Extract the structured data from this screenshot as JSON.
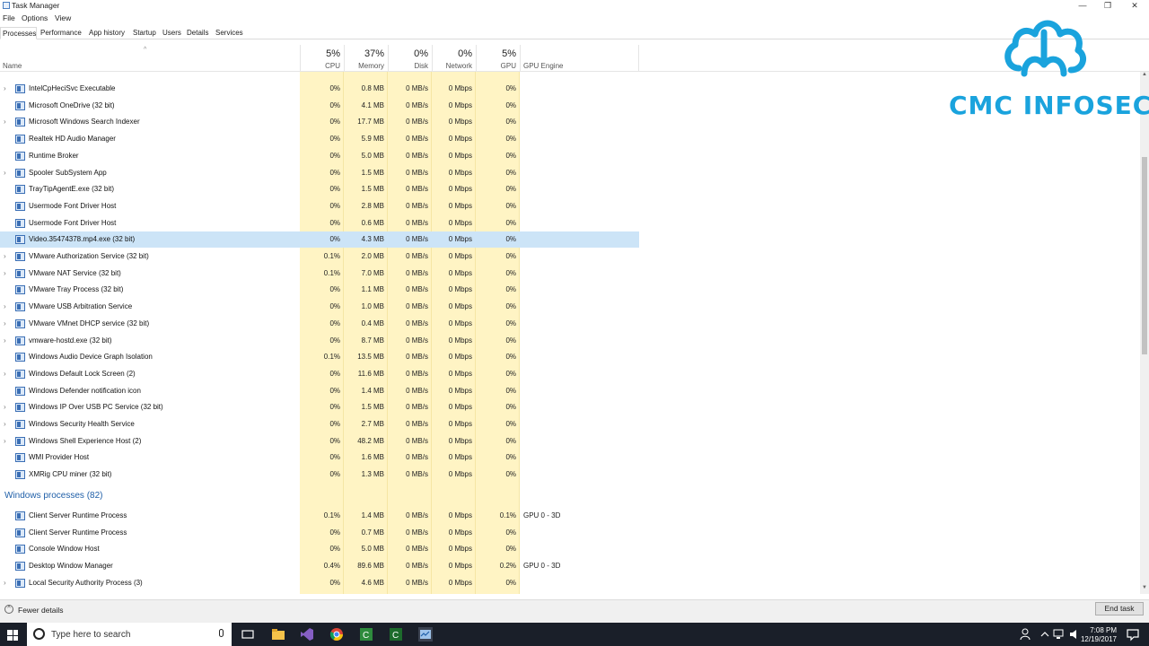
{
  "window": {
    "title": "Task Manager",
    "minimize": "—",
    "maximize": "❐",
    "close": "✕"
  },
  "menu": [
    "File",
    "Options",
    "View"
  ],
  "tabs": [
    {
      "label": "Processes",
      "active": true
    },
    {
      "label": "Performance"
    },
    {
      "label": "App history"
    },
    {
      "label": "Startup"
    },
    {
      "label": "Users"
    },
    {
      "label": "Details"
    },
    {
      "label": "Services"
    }
  ],
  "header": {
    "name": "Name",
    "gpu_engine": "GPU Engine",
    "columns": [
      {
        "pct": "5%",
        "label": "CPU"
      },
      {
        "pct": "37%",
        "label": "Memory"
      },
      {
        "pct": "0%",
        "label": "Disk"
      },
      {
        "pct": "0%",
        "label": "Network"
      },
      {
        "pct": "5%",
        "label": "GPU"
      }
    ]
  },
  "background_processes": [
    {
      "name": "IntelCpHeciSvc Executable",
      "cpu": "0%",
      "mem": "0.8 MB",
      "disk": "0 MB/s",
      "net": "0 Mbps",
      "gpu": "0%",
      "expand": true
    },
    {
      "name": "Microsoft OneDrive (32 bit)",
      "cpu": "0%",
      "mem": "4.1 MB",
      "disk": "0 MB/s",
      "net": "0 Mbps",
      "gpu": "0%",
      "expand": false
    },
    {
      "name": "Microsoft Windows Search Indexer",
      "cpu": "0%",
      "mem": "17.7 MB",
      "disk": "0 MB/s",
      "net": "0 Mbps",
      "gpu": "0%",
      "expand": true
    },
    {
      "name": "Realtek HD Audio Manager",
      "cpu": "0%",
      "mem": "5.9 MB",
      "disk": "0 MB/s",
      "net": "0 Mbps",
      "gpu": "0%",
      "expand": false
    },
    {
      "name": "Runtime Broker",
      "cpu": "0%",
      "mem": "5.0 MB",
      "disk": "0 MB/s",
      "net": "0 Mbps",
      "gpu": "0%",
      "expand": false
    },
    {
      "name": "Spooler SubSystem App",
      "cpu": "0%",
      "mem": "1.5 MB",
      "disk": "0 MB/s",
      "net": "0 Mbps",
      "gpu": "0%",
      "expand": true
    },
    {
      "name": "TrayTipAgentE.exe (32 bit)",
      "cpu": "0%",
      "mem": "1.5 MB",
      "disk": "0 MB/s",
      "net": "0 Mbps",
      "gpu": "0%",
      "expand": false
    },
    {
      "name": "Usermode Font Driver Host",
      "cpu": "0%",
      "mem": "2.8 MB",
      "disk": "0 MB/s",
      "net": "0 Mbps",
      "gpu": "0%",
      "expand": false
    },
    {
      "name": "Usermode Font Driver Host",
      "cpu": "0%",
      "mem": "0.6 MB",
      "disk": "0 MB/s",
      "net": "0 Mbps",
      "gpu": "0%",
      "expand": false
    },
    {
      "name": "Video.35474378.mp4.exe (32 bit)",
      "cpu": "0%",
      "mem": "4.3 MB",
      "disk": "0 MB/s",
      "net": "0 Mbps",
      "gpu": "0%",
      "expand": false,
      "selected": true
    },
    {
      "name": "VMware Authorization Service (32 bit)",
      "cpu": "0.1%",
      "mem": "2.0 MB",
      "disk": "0 MB/s",
      "net": "0 Mbps",
      "gpu": "0%",
      "expand": true
    },
    {
      "name": "VMware NAT Service (32 bit)",
      "cpu": "0.1%",
      "mem": "7.0 MB",
      "disk": "0 MB/s",
      "net": "0 Mbps",
      "gpu": "0%",
      "expand": true
    },
    {
      "name": "VMware Tray Process (32 bit)",
      "cpu": "0%",
      "mem": "1.1 MB",
      "disk": "0 MB/s",
      "net": "0 Mbps",
      "gpu": "0%",
      "expand": false
    },
    {
      "name": "VMware USB Arbitration Service",
      "cpu": "0%",
      "mem": "1.0 MB",
      "disk": "0 MB/s",
      "net": "0 Mbps",
      "gpu": "0%",
      "expand": true
    },
    {
      "name": "VMware VMnet DHCP service (32 bit)",
      "cpu": "0%",
      "mem": "0.4 MB",
      "disk": "0 MB/s",
      "net": "0 Mbps",
      "gpu": "0%",
      "expand": true
    },
    {
      "name": "vmware-hostd.exe (32 bit)",
      "cpu": "0%",
      "mem": "8.7 MB",
      "disk": "0 MB/s",
      "net": "0 Mbps",
      "gpu": "0%",
      "expand": true
    },
    {
      "name": "Windows Audio Device Graph Isolation",
      "cpu": "0.1%",
      "mem": "13.5 MB",
      "disk": "0 MB/s",
      "net": "0 Mbps",
      "gpu": "0%",
      "expand": false
    },
    {
      "name": "Windows Default Lock Screen (2)",
      "cpu": "0%",
      "mem": "11.6 MB",
      "disk": "0 MB/s",
      "net": "0 Mbps",
      "gpu": "0%",
      "expand": true
    },
    {
      "name": "Windows Defender notification icon",
      "cpu": "0%",
      "mem": "1.4 MB",
      "disk": "0 MB/s",
      "net": "0 Mbps",
      "gpu": "0%",
      "expand": false
    },
    {
      "name": "Windows IP Over USB PC Service (32 bit)",
      "cpu": "0%",
      "mem": "1.5 MB",
      "disk": "0 MB/s",
      "net": "0 Mbps",
      "gpu": "0%",
      "expand": true
    },
    {
      "name": "Windows Security Health Service",
      "cpu": "0%",
      "mem": "2.7 MB",
      "disk": "0 MB/s",
      "net": "0 Mbps",
      "gpu": "0%",
      "expand": true
    },
    {
      "name": "Windows Shell Experience Host (2)",
      "cpu": "0%",
      "mem": "48.2 MB",
      "disk": "0 MB/s",
      "net": "0 Mbps",
      "gpu": "0%",
      "expand": true
    },
    {
      "name": "WMI Provider Host",
      "cpu": "0%",
      "mem": "1.6 MB",
      "disk": "0 MB/s",
      "net": "0 Mbps",
      "gpu": "0%",
      "expand": false
    },
    {
      "name": "XMRig CPU miner (32 bit)",
      "cpu": "0%",
      "mem": "1.3 MB",
      "disk": "0 MB/s",
      "net": "0 Mbps",
      "gpu": "0%",
      "expand": false
    }
  ],
  "section_windows": "Windows processes (82)",
  "windows_processes": [
    {
      "name": "Client Server Runtime Process",
      "cpu": "0.1%",
      "mem": "1.4 MB",
      "disk": "0 MB/s",
      "net": "0 Mbps",
      "gpu": "0.1%",
      "gpu_engine": "GPU 0 - 3D",
      "expand": false
    },
    {
      "name": "Client Server Runtime Process",
      "cpu": "0%",
      "mem": "0.7 MB",
      "disk": "0 MB/s",
      "net": "0 Mbps",
      "gpu": "0%",
      "gpu_engine": "",
      "expand": false
    },
    {
      "name": "Console Window Host",
      "cpu": "0%",
      "mem": "5.0 MB",
      "disk": "0 MB/s",
      "net": "0 Mbps",
      "gpu": "0%",
      "gpu_engine": "",
      "expand": false
    },
    {
      "name": "Desktop Window Manager",
      "cpu": "0.4%",
      "mem": "89.6 MB",
      "disk": "0 MB/s",
      "net": "0 Mbps",
      "gpu": "0.2%",
      "gpu_engine": "GPU 0 - 3D",
      "expand": false
    },
    {
      "name": "Local Security Authority Process (3)",
      "cpu": "0%",
      "mem": "4.6 MB",
      "disk": "0 MB/s",
      "net": "0 Mbps",
      "gpu": "0%",
      "gpu_engine": "",
      "expand": true
    }
  ],
  "footer": {
    "fewer_details": "Fewer details",
    "end_task": "End task"
  },
  "taskbar": {
    "search_placeholder": "Type here to search",
    "time": "7:08 PM",
    "date": "12/19/2017"
  },
  "watermark": {
    "text": "CMC INFOSEC",
    "color": "#1aa3dd"
  },
  "colors": {
    "column_bg": "#fff4c4",
    "selected_row": "#cce4f7",
    "section_header": "#1f5fa8"
  }
}
